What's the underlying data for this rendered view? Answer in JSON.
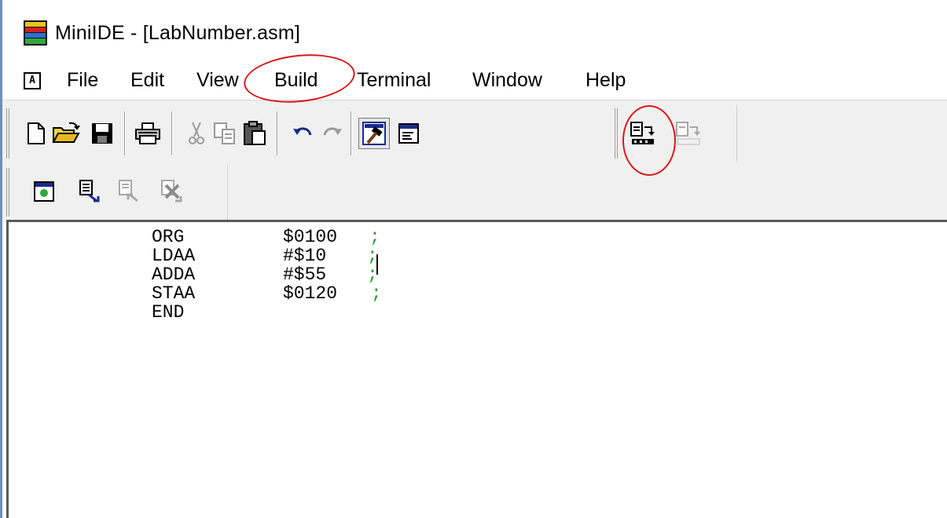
{
  "window": {
    "title": "MiniIDE - [LabNumber.asm]"
  },
  "menu": {
    "doc_icon_letter": "A",
    "items": [
      "File",
      "Edit",
      "View",
      "Build",
      "Terminal",
      "Window",
      "Help"
    ]
  },
  "toolbar1": {
    "buttons": [
      {
        "icon": "new-file-icon"
      },
      {
        "icon": "open-folder-icon"
      },
      {
        "icon": "save-icon"
      },
      {
        "icon": "print-icon"
      },
      {
        "icon": "cut-icon",
        "disabled": true
      },
      {
        "icon": "copy-icon",
        "disabled": true
      },
      {
        "icon": "paste-icon"
      },
      {
        "icon": "undo-icon"
      },
      {
        "icon": "redo-icon",
        "disabled": true
      },
      {
        "icon": "build-hammer-icon",
        "pressed": true
      },
      {
        "icon": "output-window-icon"
      },
      {
        "icon": "assemble-icon"
      },
      {
        "icon": "assemble-disabled-icon",
        "disabled": true
      }
    ]
  },
  "toolbar2": {
    "buttons": [
      {
        "icon": "terminal-window-icon"
      },
      {
        "icon": "download-icon"
      },
      {
        "icon": "upload-icon",
        "disabled": true
      },
      {
        "icon": "cancel-transfer-icon",
        "disabled": true
      }
    ]
  },
  "editor": {
    "lines": [
      {
        "mnemonic": "ORG",
        "operand": "$0100",
        "comment": ";"
      },
      {
        "mnemonic": "LDAA",
        "operand": "#$10",
        "comment": ";"
      },
      {
        "mnemonic": "ADDA",
        "operand": "#$55",
        "comment": ";"
      },
      {
        "mnemonic": "STAA",
        "operand": "$0120",
        "comment": ";"
      },
      {
        "mnemonic": "END",
        "operand": "",
        "comment": ""
      }
    ]
  },
  "colors": {
    "annotation": "#d81818",
    "comment": "#2e9a2e",
    "window_edge": "#6a8fc0"
  }
}
